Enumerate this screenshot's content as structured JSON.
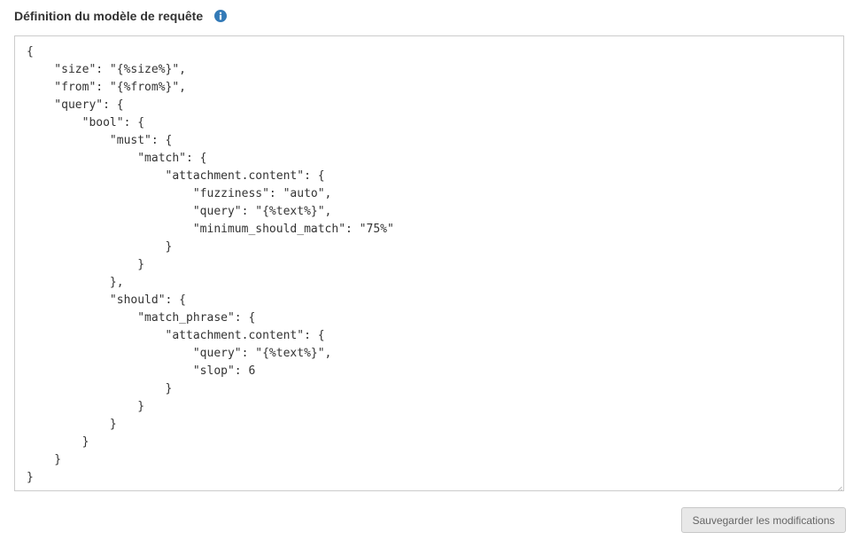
{
  "header": {
    "title": "Définition du modèle de requête",
    "info_icon": "info-circle-icon"
  },
  "editor": {
    "content": "{\n    \"size\": \"{%size%}\",\n    \"from\": \"{%from%}\",\n    \"query\": {\n        \"bool\": {\n            \"must\": {\n                \"match\": {\n                    \"attachment.content\": {\n                        \"fuzziness\": \"auto\",\n                        \"query\": \"{%text%}\",\n                        \"minimum_should_match\": \"75%\"\n                    }\n                }\n            },\n            \"should\": {\n                \"match_phrase\": {\n                    \"attachment.content\": {\n                        \"query\": \"{%text%}\",\n                        \"slop\": 6\n                    }\n                }\n            }\n        }\n    }\n}"
  },
  "actions": {
    "save_label": "Sauvegarder les modifications"
  },
  "colors": {
    "accent": "#337ab7",
    "border": "#cccccc",
    "button_bg": "#e8e8e8"
  }
}
